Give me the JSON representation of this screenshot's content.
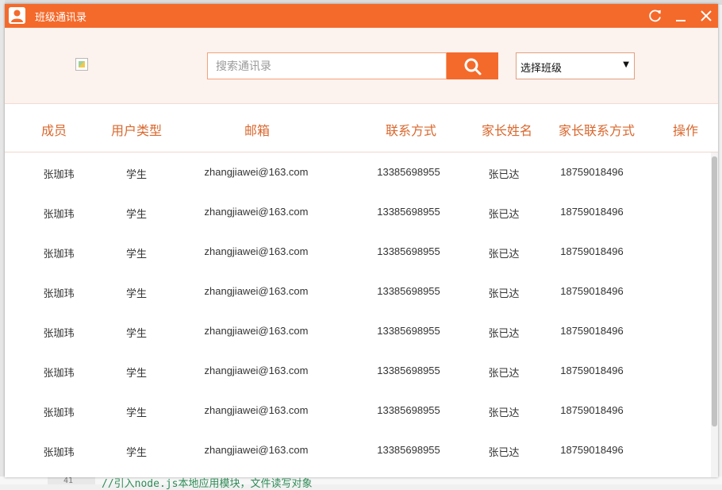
{
  "window": {
    "title": "班级通讯录",
    "accent_color": "#f46a2b",
    "icons": [
      "user-icon",
      "refresh-icon",
      "minimize-icon",
      "close-icon"
    ]
  },
  "search": {
    "placeholder": "搜索通讯录",
    "value": "",
    "button_icon": "search-icon",
    "class_select": {
      "selected": "选择班级"
    }
  },
  "table": {
    "columns": [
      "成员",
      "用户类型",
      "邮箱",
      "联系方式",
      "家长姓名",
      "家长联系方式",
      "操作"
    ],
    "rows": [
      [
        "张珈玮",
        "学生",
        "zhangjiawei@163.com",
        "13385698955",
        "张已达",
        "18759018496"
      ],
      [
        "张珈玮",
        "学生",
        "zhangjiawei@163.com",
        "13385698955",
        "张已达",
        "18759018496"
      ],
      [
        "张珈玮",
        "学生",
        "zhangjiawei@163.com",
        "13385698955",
        "张已达",
        "18759018496"
      ],
      [
        "张珈玮",
        "学生",
        "zhangjiawei@163.com",
        "13385698955",
        "张已达",
        "18759018496"
      ],
      [
        "张珈玮",
        "学生",
        "zhangjiawei@163.com",
        "13385698955",
        "张已达",
        "18759018496"
      ],
      [
        "张珈玮",
        "学生",
        "zhangjiawei@163.com",
        "13385698955",
        "张已达",
        "18759018496"
      ],
      [
        "张珈玮",
        "学生",
        "zhangjiawei@163.com",
        "13385698955",
        "张已达",
        "18759018496"
      ],
      [
        "张珈玮",
        "学生",
        "zhangjiawei@163.com",
        "13385698955",
        "张已达",
        "18759018496"
      ]
    ]
  },
  "background": {
    "code_line": "//引入node.js本地应用模块，文件读写对象",
    "line_number": "41"
  }
}
